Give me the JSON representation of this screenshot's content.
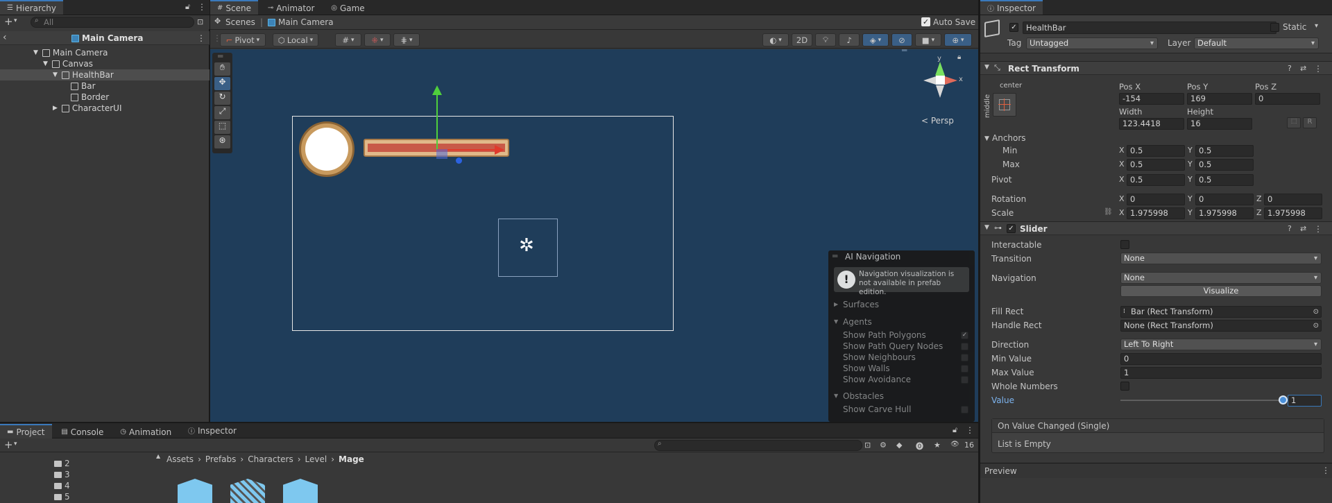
{
  "hierarchy": {
    "tab_label": "Hierarchy",
    "search_placeholder": "All",
    "scene_title": "Main Camera",
    "items": [
      {
        "label": "Main Camera"
      },
      {
        "label": "Canvas"
      },
      {
        "label": "HealthBar"
      },
      {
        "label": "Bar"
      },
      {
        "label": "Border"
      },
      {
        "label": "CharacterUI"
      }
    ]
  },
  "scene": {
    "tabs": [
      {
        "label": "Scene"
      },
      {
        "label": "Animator"
      },
      {
        "label": "Game"
      }
    ],
    "breadcrumb": {
      "root": "Scenes",
      "current": "Main Camera"
    },
    "auto_save_label": "Auto Save",
    "auto_save_checked": true,
    "pivot_label": "Pivot",
    "local_label": "Local",
    "btn_2d": "2D",
    "persp_label": "< Persp",
    "gizmo_y": "y",
    "gizmo_x": "x"
  },
  "ai_navigation": {
    "title": "AI Navigation",
    "warning": "Navigation visualization is not available in prefab edition.",
    "surfaces": "Surfaces",
    "agents": "Agents",
    "agent_options": [
      {
        "label": "Show Path Polygons",
        "checked": true
      },
      {
        "label": "Show Path Query Nodes",
        "checked": false
      },
      {
        "label": "Show Neighbours",
        "checked": false
      },
      {
        "label": "Show Walls",
        "checked": false
      },
      {
        "label": "Show Avoidance",
        "checked": false
      }
    ],
    "obstacles": "Obstacles",
    "obstacle_options": [
      {
        "label": "Show Carve Hull",
        "checked": false
      }
    ]
  },
  "project": {
    "tabs": [
      {
        "label": "Project"
      },
      {
        "label": "Console"
      },
      {
        "label": "Animation"
      },
      {
        "label": "Inspector"
      }
    ],
    "folders": [
      "2",
      "3",
      "4",
      "5"
    ],
    "breadcrumb": [
      "Assets",
      "Prefabs",
      "Characters",
      "Level",
      "Mage"
    ],
    "visibility_count": "16"
  },
  "inspector": {
    "tab_label": "Inspector",
    "object_name": "HealthBar",
    "static_label": "Static",
    "tag_label": "Tag",
    "tag_value": "Untagged",
    "layer_label": "Layer",
    "layer_value": "Default",
    "rect_transform": {
      "title": "Rect Transform",
      "anchor_h": "center",
      "anchor_v": "middle",
      "pos_x_label": "Pos X",
      "pos_x": "-154",
      "pos_y_label": "Pos Y",
      "pos_y": "169",
      "pos_z_label": "Pos Z",
      "pos_z": "0",
      "width_label": "Width",
      "width": "123.4418",
      "height_label": "Height",
      "height": "16",
      "anchors_label": "Anchors",
      "min_label": "Min",
      "min_x": "0.5",
      "min_y": "0.5",
      "max_label": "Max",
      "max_x": "0.5",
      "max_y": "0.5",
      "pivot_label": "Pivot",
      "pivot_x": "0.5",
      "pivot_y": "0.5",
      "rotation_label": "Rotation",
      "rot_x": "0",
      "rot_y": "0",
      "rot_z": "0",
      "scale_label": "Scale",
      "scale_x": "1.975998",
      "scale_y": "1.975998",
      "scale_z": "1.975998",
      "x": "X",
      "y": "Y",
      "z": "Z",
      "r_btn": "R"
    },
    "slider": {
      "title": "Slider",
      "interactable_label": "Interactable",
      "transition_label": "Transition",
      "transition_value": "None",
      "navigation_label": "Navigation",
      "navigation_value": "None",
      "visualize_label": "Visualize",
      "fill_rect_label": "Fill Rect",
      "fill_rect_value": "Bar (Rect Transform)",
      "handle_rect_label": "Handle Rect",
      "handle_rect_value": "None (Rect Transform)",
      "direction_label": "Direction",
      "direction_value": "Left To Right",
      "min_value_label": "Min Value",
      "min_value": "0",
      "max_value_label": "Max Value",
      "max_value": "1",
      "whole_numbers_label": "Whole Numbers",
      "value_label": "Value",
      "value": "1",
      "slider_level": 1.0,
      "event_title": "On Value Changed (Single)",
      "list_empty": "List is Empty"
    },
    "preview_label": "Preview"
  },
  "colors": {
    "accent": "#3a79bb",
    "scene_bg": "#1f3d5a",
    "handle": "#4a8fd8"
  }
}
